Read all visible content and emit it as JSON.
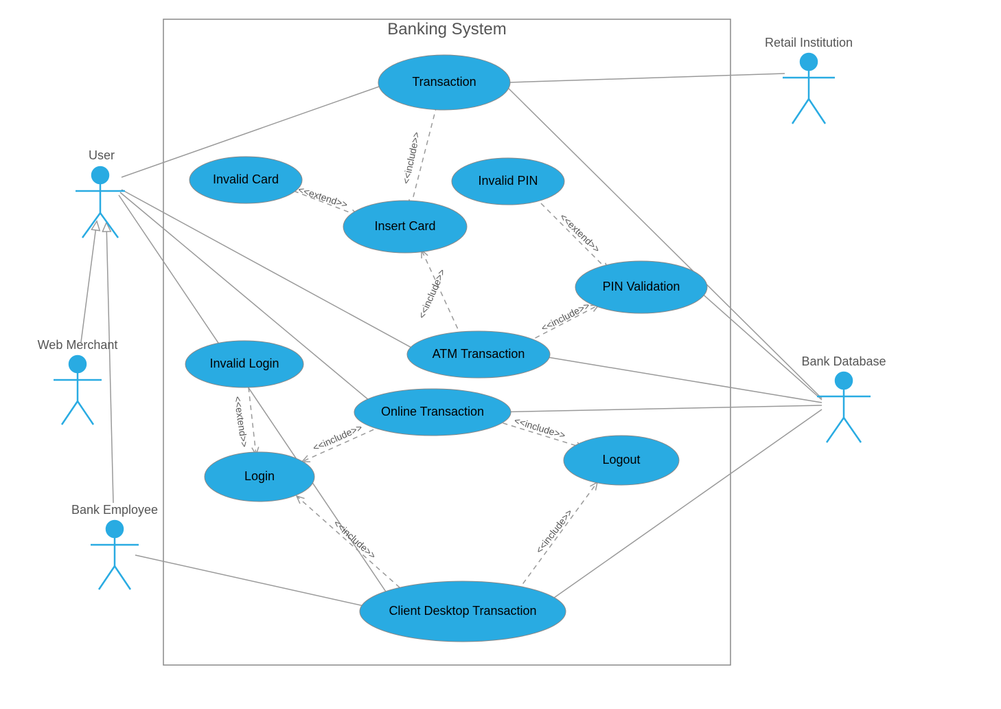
{
  "system": {
    "title": "Banking System"
  },
  "actors": {
    "user": "User",
    "web_merchant": "Web Merchant",
    "bank_employee": "Bank Employee",
    "retail_institution": "Retail Institution",
    "bank_database": "Bank Database"
  },
  "usecases": {
    "transaction": "Transaction",
    "invalid_card": "Invalid Card",
    "insert_card": "Insert Card",
    "invalid_pin": "Invalid PIN",
    "pin_validation": "PIN Validation",
    "atm_transaction": "ATM Transaction",
    "invalid_login": "Invalid Login",
    "online_transaction": "Online Transaction",
    "login": "Login",
    "logout": "Logout",
    "client_desktop_transaction": "Client Desktop Transaction"
  },
  "stereotypes": {
    "include": "<<include>>",
    "extend": "<<extend>>"
  },
  "colors": {
    "usecase_fill": "#29abe2",
    "stroke": "#888888",
    "edge": "#999999"
  }
}
